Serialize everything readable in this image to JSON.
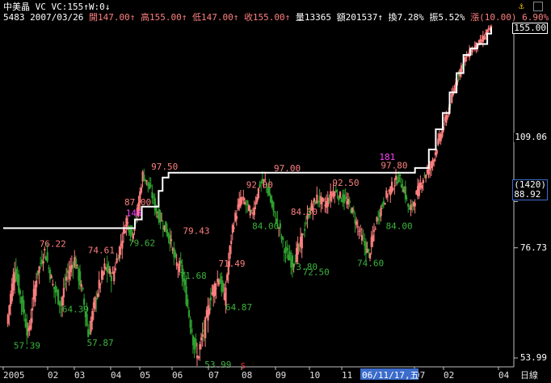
{
  "header": {
    "line1": {
      "stock": "中美晶",
      "indicator": "VC VC:155↑W:0↓",
      "alert_icon": "bell-icon"
    },
    "line2": {
      "code": "5483",
      "date": "2007/03/26",
      "fields": [
        {
          "label": "開",
          "value": "147.00",
          "arrow": "↑"
        },
        {
          "label": "高",
          "value": "155.00",
          "arrow": "↑"
        },
        {
          "label": "低",
          "value": "147.00",
          "arrow": "↑"
        },
        {
          "label": "收",
          "value": "155.00",
          "arrow": "↑"
        },
        {
          "label": "量",
          "value": "13365",
          "arrow": ""
        },
        {
          "label": "額",
          "value": "201537",
          "arrow": "↑"
        },
        {
          "label": "換",
          "value": "7.28%",
          "arrow": ""
        },
        {
          "label": "振",
          "value": "5.52%",
          "arrow": ""
        },
        {
          "label": "漲",
          "value": "(10.00)",
          "arrow": ""
        },
        {
          "label": "",
          "value": "6.90%",
          "arrow": ""
        }
      ]
    }
  },
  "colors": {
    "background": "#000000",
    "up": "#ff7f7f",
    "down": "#2ea02e",
    "line": "#ffffff",
    "axis": "#c0c0c0",
    "label_high": "#ff7f7f",
    "label_low": "#3cb43c",
    "label_pattern": "#ff40ff",
    "cursor_box": "#3c6ccc"
  },
  "chart_data": {
    "type": "candlestick",
    "period": "weekly",
    "yaxis": {
      "ticks": [
        "155.00",
        "109.06",
        "88.92",
        "76.73",
        "53.99"
      ],
      "tick_values": [
        155.0,
        109.06,
        88.92,
        76.73,
        53.99
      ],
      "extra_label": "(1420)",
      "current_price": "155.00"
    },
    "xaxis": {
      "labels": [
        "2005",
        "02",
        "03",
        "04",
        "05",
        "06",
        "07",
        "08",
        "09",
        "10",
        "11",
        "07",
        "02",
        "04"
      ],
      "highlight": "06/11/17,五",
      "unit_label": "日線",
      "marker": "S"
    },
    "annotations_high": [
      {
        "text": "76.22",
        "date": "2005-01-05",
        "value": 76.22
      },
      {
        "text": "74.61",
        "date": "2005-02-23",
        "value": 74.61
      },
      {
        "text": "87.00",
        "date": "2005-04-01",
        "value": 87.0
      },
      {
        "text": "97.50",
        "date": "2005-04-28",
        "value": 97.5
      },
      {
        "text": "79.43",
        "date": "2005-05-30",
        "value": 79.43
      },
      {
        "text": "71.49",
        "date": "2005-07-05",
        "value": 71.49
      },
      {
        "text": "92.00",
        "date": "2005-08-02",
        "value": 92.0
      },
      {
        "text": "97.00",
        "date": "2005-08-30",
        "value": 97.0
      },
      {
        "text": "84.30",
        "date": "2005-09-16",
        "value": 84.3
      },
      {
        "text": "92.50",
        "date": "2005-10-28",
        "value": 92.5
      },
      {
        "text": "97.80",
        "date": "2005-12-16",
        "value": 97.8
      }
    ],
    "annotations_low": [
      {
        "text": "57.39",
        "date": "2004-12-10",
        "value": 57.39
      },
      {
        "text": "64.39",
        "date": "2005-01-28",
        "value": 64.39
      },
      {
        "text": "57.87",
        "date": "2005-02-22",
        "value": 57.87
      },
      {
        "text": "79.62",
        "date": "2005-04-05",
        "value": 79.62
      },
      {
        "text": "71.68",
        "date": "2005-05-27",
        "value": 71.68
      },
      {
        "text": "53.99",
        "date": "2005-06-21",
        "value": 53.99
      },
      {
        "text": "64.87",
        "date": "2005-07-12",
        "value": 64.87
      },
      {
        "text": "84.00",
        "date": "2005-08-08",
        "value": 84.0
      },
      {
        "text": "73.80",
        "date": "2005-09-16",
        "value": 73.8
      },
      {
        "text": "72.50",
        "date": "2005-09-28",
        "value": 72.5
      },
      {
        "text": "74.60",
        "date": "2005-11-22",
        "value": 74.6
      },
      {
        "text": "84.00",
        "date": "2005-12-21",
        "value": 84.0
      }
    ],
    "annotations_pattern": [
      {
        "text": "146",
        "date": "2005-03-28",
        "value": 84.0
      },
      {
        "text": "181",
        "date": "2005-12-09",
        "value": 100.5
      }
    ],
    "resistance_line": [
      {
        "date": "2004-11-16",
        "value": 81.7
      },
      {
        "date": "2005-03-29",
        "value": 81.7
      },
      {
        "date": "2005-03-29",
        "value": 84.0
      },
      {
        "date": "2005-04-05",
        "value": 84.0
      },
      {
        "date": "2005-04-05",
        "value": 87.5
      },
      {
        "date": "2005-04-22",
        "value": 87.5
      },
      {
        "date": "2005-04-22",
        "value": 92.0
      },
      {
        "date": "2005-04-26",
        "value": 92.0
      },
      {
        "date": "2005-04-26",
        "value": 96.0
      },
      {
        "date": "2005-05-02",
        "value": 96.0
      },
      {
        "date": "2005-05-02",
        "value": 97.5
      },
      {
        "date": "2006-01-06",
        "value": 97.5
      },
      {
        "date": "2006-01-06",
        "value": 99.0
      },
      {
        "date": "2006-01-20",
        "value": 99.0
      },
      {
        "date": "2006-01-20",
        "value": 105.0
      },
      {
        "date": "2006-01-27",
        "value": 105.0
      },
      {
        "date": "2006-01-27",
        "value": 112.0
      },
      {
        "date": "2006-02-03",
        "value": 112.0
      },
      {
        "date": "2006-02-03",
        "value": 118.0
      },
      {
        "date": "2006-02-10",
        "value": 118.0
      },
      {
        "date": "2006-02-10",
        "value": 126.0
      },
      {
        "date": "2006-02-17",
        "value": 126.0
      },
      {
        "date": "2006-02-17",
        "value": 134.0
      },
      {
        "date": "2006-02-24",
        "value": 134.0
      },
      {
        "date": "2006-02-24",
        "value": 142.0
      },
      {
        "date": "2006-03-03",
        "value": 142.0
      },
      {
        "date": "2006-03-03",
        "value": 145.0
      },
      {
        "date": "2006-03-10",
        "value": 145.0
      },
      {
        "date": "2006-03-10",
        "value": 147.0
      },
      {
        "date": "2006-03-20",
        "value": 147.0
      },
      {
        "date": "2006-03-20",
        "value": 152.0
      },
      {
        "date": "2006-03-24",
        "value": 152.0
      },
      {
        "date": "2006-03-24",
        "value": 155.0
      }
    ],
    "candles_note": "open/high/low/close series approximated from the price path",
    "price_path": [
      [
        0,
        60
      ],
      [
        6,
        72
      ],
      [
        10,
        66
      ],
      [
        16,
        58
      ],
      [
        22,
        70
      ],
      [
        28,
        76
      ],
      [
        34,
        68
      ],
      [
        40,
        64
      ],
      [
        44,
        70
      ],
      [
        50,
        74
      ],
      [
        56,
        66
      ],
      [
        60,
        58
      ],
      [
        66,
        66
      ],
      [
        72,
        72
      ],
      [
        78,
        70
      ],
      [
        84,
        78
      ],
      [
        88,
        84
      ],
      [
        92,
        80
      ],
      [
        96,
        86
      ],
      [
        100,
        97
      ],
      [
        106,
        92
      ],
      [
        110,
        86
      ],
      [
        116,
        82
      ],
      [
        120,
        79
      ],
      [
        124,
        73
      ],
      [
        128,
        72
      ],
      [
        134,
        62
      ],
      [
        138,
        56
      ],
      [
        140,
        54
      ],
      [
        146,
        60
      ],
      [
        150,
        66
      ],
      [
        156,
        70
      ],
      [
        160,
        65
      ],
      [
        166,
        82
      ],
      [
        172,
        90
      ],
      [
        176,
        88
      ],
      [
        180,
        85
      ],
      [
        186,
        94
      ],
      [
        190,
        95
      ],
      [
        196,
        86
      ],
      [
        200,
        82
      ],
      [
        204,
        76
      ],
      [
        210,
        73
      ],
      [
        216,
        78
      ],
      [
        222,
        86
      ],
      [
        228,
        90
      ],
      [
        234,
        88
      ],
      [
        240,
        92
      ],
      [
        246,
        90
      ],
      [
        252,
        88
      ],
      [
        256,
        84
      ],
      [
        262,
        78
      ],
      [
        266,
        75
      ],
      [
        272,
        84
      ],
      [
        278,
        90
      ],
      [
        284,
        94
      ],
      [
        288,
        96
      ],
      [
        292,
        92
      ],
      [
        296,
        86
      ],
      [
        300,
        90
      ],
      [
        306,
        96
      ],
      [
        312,
        100
      ],
      [
        316,
        106
      ],
      [
        320,
        112
      ],
      [
        324,
        118
      ],
      [
        328,
        126
      ],
      [
        332,
        134
      ],
      [
        336,
        140
      ],
      [
        340,
        143
      ],
      [
        344,
        146
      ],
      [
        348,
        148
      ],
      [
        352,
        152
      ],
      [
        356,
        155
      ]
    ]
  }
}
